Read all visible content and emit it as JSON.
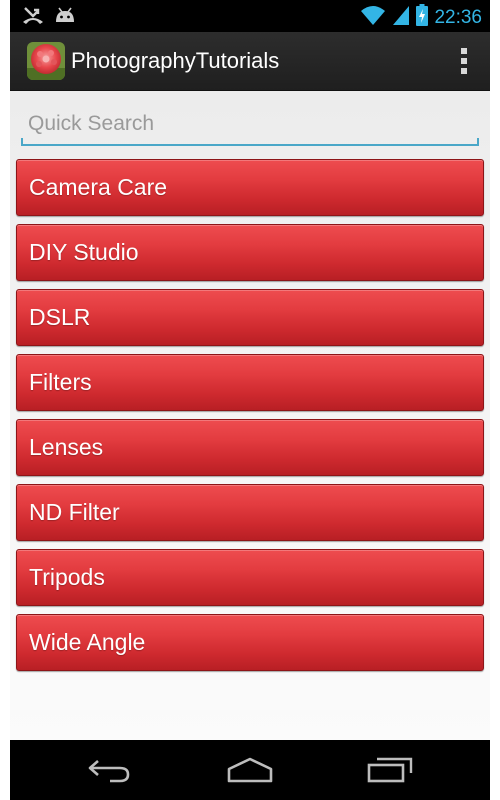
{
  "status_bar": {
    "time": "22:36",
    "icons": [
      "missed-call-icon",
      "android-icon",
      "wifi-icon",
      "signal-icon",
      "battery-charging-icon"
    ]
  },
  "action_bar": {
    "title": "PhotographyTutorials",
    "app_icon": "flower-app-icon",
    "overflow_icon": "overflow-menu-icon"
  },
  "search": {
    "placeholder": "Quick Search",
    "value": ""
  },
  "categories": [
    "Camera Care",
    "DIY Studio",
    "DSLR",
    "Filters",
    "Lenses",
    "ND Filter",
    "Tripods",
    "Wide Angle"
  ],
  "nav_bar": {
    "icons": [
      "back-icon",
      "home-icon",
      "recents-icon"
    ]
  },
  "colors": {
    "button_red": "#e33c40",
    "accent_blue": "#33b5e5",
    "action_bar": "#262626"
  }
}
